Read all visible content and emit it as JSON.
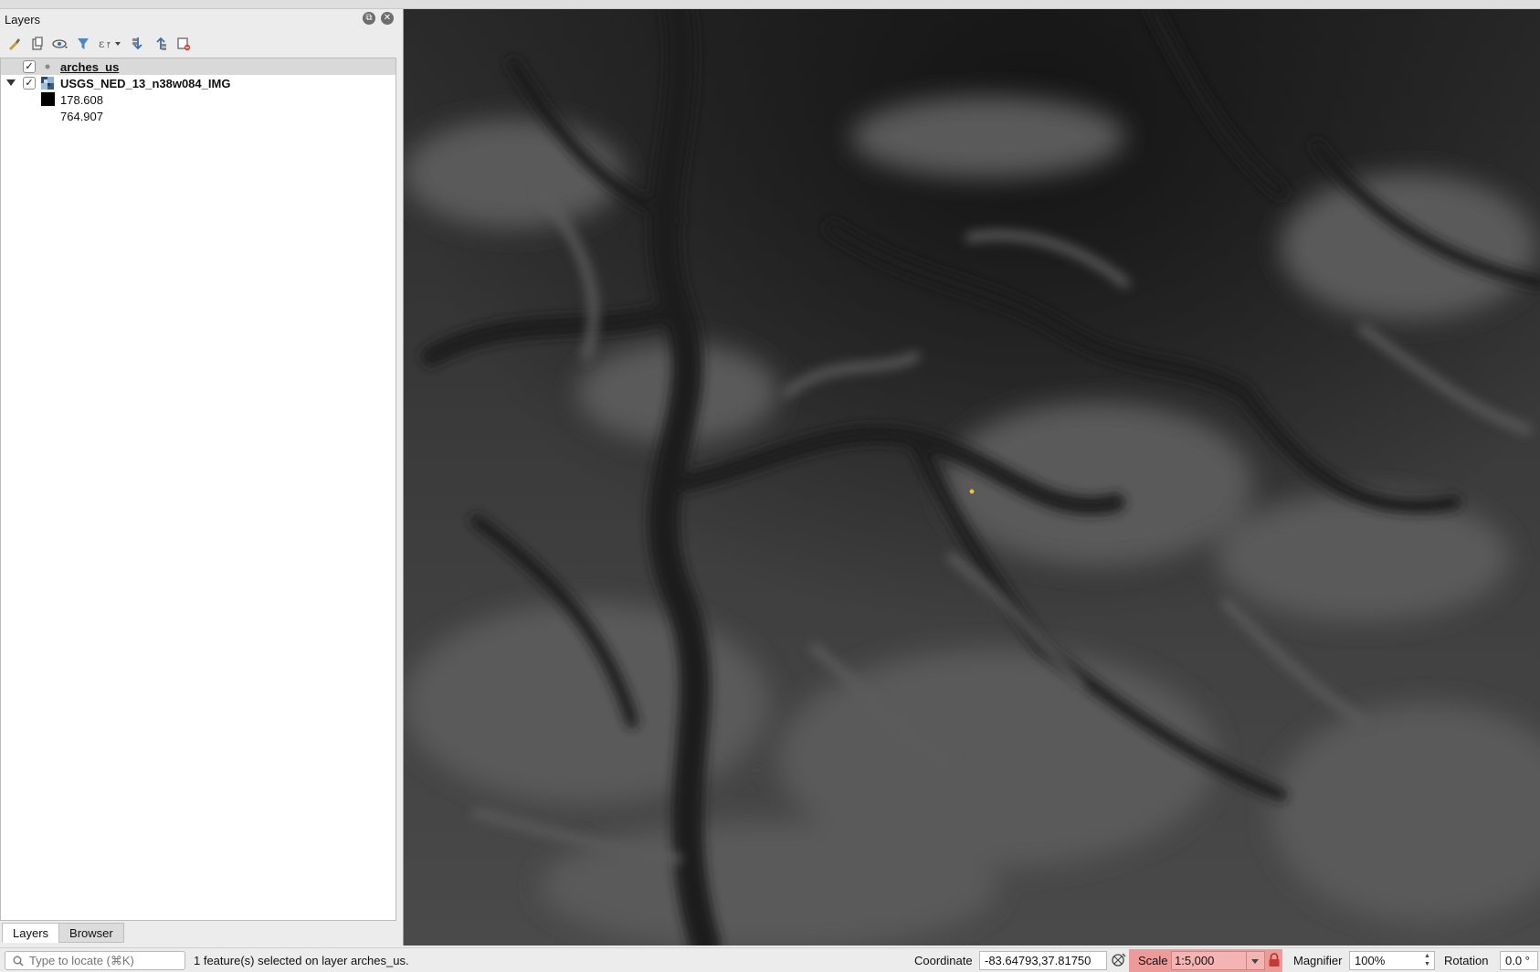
{
  "dock": {
    "title": "Layers",
    "layers": [
      {
        "name": "arches_us",
        "checked": true,
        "selected": true
      },
      {
        "name": "USGS_NED_13_n38w084_IMG",
        "checked": true,
        "expanded": true
      }
    ],
    "legend": {
      "min": "178.608",
      "max": "764.907"
    },
    "toolbar_icons": [
      "style-manager-icon",
      "add-group-icon",
      "manage-visibility-icon",
      "filter-legend-icon",
      "filter-expression-icon",
      "expand-all-icon",
      "collapse-all-icon",
      "remove-layer-icon"
    ],
    "tabs": [
      {
        "label": "Layers",
        "active": true
      },
      {
        "label": "Browser",
        "active": false
      }
    ]
  },
  "map": {
    "feature_color": "#f2c230"
  },
  "status": {
    "locator_placeholder": "Type to locate (⌘K)",
    "message": "1 feature(s) selected on layer arches_us.",
    "coordinate_label": "Coordinate",
    "coordinate_value": "-83.64793,37.81750",
    "scale_label": "Scale",
    "scale_value": "1:5,000",
    "magnifier_label": "Magnifier",
    "magnifier_value": "100%",
    "rotation_label": "Rotation",
    "rotation_value": "0.0 °"
  }
}
